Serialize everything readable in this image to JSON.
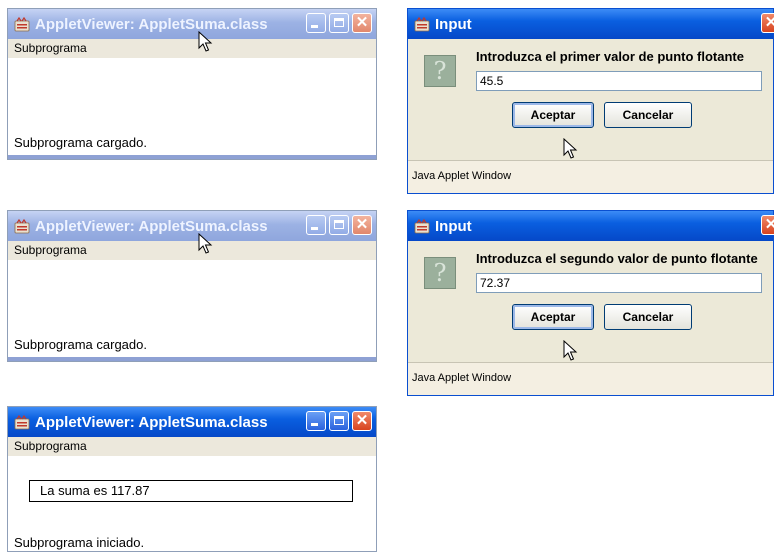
{
  "windows": [
    {
      "title": "AppletViewer: AppletSuma.class",
      "menu": "Subprograma",
      "status": "Subprograma cargado.",
      "result": null
    },
    {
      "title": "AppletViewer: AppletSuma.class",
      "menu": "Subprograma",
      "status": "Subprograma cargado.",
      "result": null
    },
    {
      "title": "AppletViewer: AppletSuma.class",
      "menu": "Subprograma",
      "status": "Subprograma iniciado.",
      "result": "La suma es 117.87"
    }
  ],
  "dialogs": [
    {
      "title": "Input",
      "prompt": "Introduzca el primer valor de punto flotante",
      "value": "45.5",
      "ok_label": "Aceptar",
      "cancel_label": "Cancelar",
      "footer": "Java Applet Window"
    },
    {
      "title": "Input",
      "prompt": "Introduzca el segundo valor de punto flotante",
      "value": "72.37",
      "ok_label": "Aceptar",
      "cancel_label": "Cancelar",
      "footer": "Java Applet Window"
    }
  ],
  "icons": {
    "app": "java-applet-icon",
    "question": "question-icon",
    "cursor": "mouse-cursor-icon"
  },
  "colors": {
    "active_title": "#0a5fe0",
    "inactive_title": "#9cb2e4",
    "dialog_bg": "#ece9d8",
    "menu_bg": "#ece8dc",
    "close_button": "#d8431f"
  }
}
